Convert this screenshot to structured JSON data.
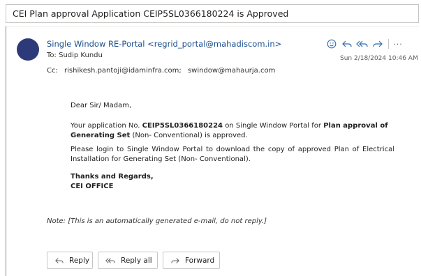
{
  "subject": "CEI Plan approval Application CEIP5SL0366180224 is Approved",
  "sender": "Single Window RE-Portal <regrid_portal@mahadiscom.in>",
  "to": {
    "label": "To:",
    "name": "Sudip Kundu"
  },
  "cc": {
    "label": "Cc:",
    "recipients": [
      "rishikesh.pantoji@idaminfra.com;",
      "swindow@mahaurja.com"
    ]
  },
  "date": "Sun 2/18/2024 10:46 AM",
  "icons": {
    "emoji": "smiley-icon",
    "reply": "reply-icon",
    "reply_all": "reply-all-icon",
    "forward": "forward-icon",
    "more": "more-icon"
  },
  "body": {
    "greeting": "Dear Sir/ Madam,",
    "para1_prefix": "Your application No.",
    "app_no": "CEIP5SL0366180224",
    "para1_middle": "on Single Window Portal for",
    "plan_label": "Plan approval of Generating Set",
    "para1_suffix": "(Non- Conventional) is approved.",
    "para2": "Please login to Single Window Portal to download the copy of approved Plan of Electrical Installation for Generating Set (Non- Conventional).",
    "thanks": "Thanks and Regards,",
    "signature": "CEI OFFICE"
  },
  "note": "Note: [This is an automatically generated e-mail, do not reply.]",
  "buttons": {
    "reply": "Reply",
    "reply_all": "Reply all",
    "forward": "Forward"
  },
  "colors": {
    "accent": "#2b6cb0",
    "sender": "#1b4f8f",
    "avatar": "#2d3a7a"
  }
}
